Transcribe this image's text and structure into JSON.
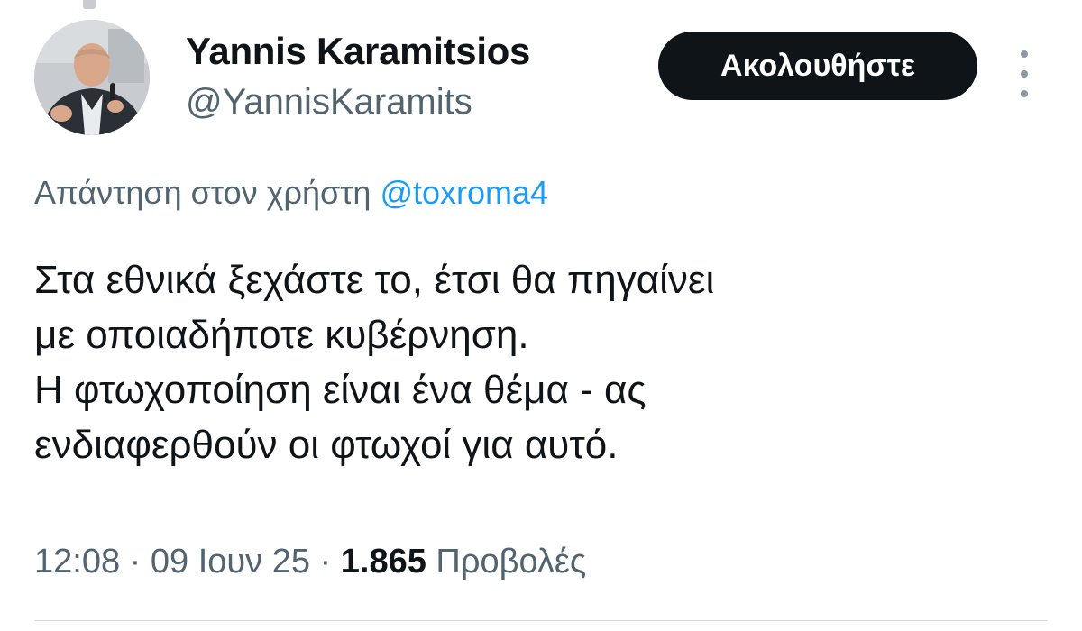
{
  "author": {
    "display_name": "Yannis Karamitsios",
    "handle": "@YannisKaramits",
    "avatar_icon": "profile-photo"
  },
  "follow_button": {
    "label": "Ακολουθήστε"
  },
  "reply_context": {
    "prefix": "Απάντηση στον χρήστη ",
    "mention": "@toxroma4"
  },
  "tweet": {
    "lines": [
      "Στα εθνικά ξεχάστε το, έτσι θα πηγαίνει",
      "με οποιαδήποτε κυβέρνηση.",
      "Η φτωχοποίηση είναι ένα θέμα - ας",
      "ενδιαφερθούν οι φτωχοί για αυτό."
    ]
  },
  "meta": {
    "time": "12:08",
    "separator": " · ",
    "date": "09 Ιουν 25",
    "views_count": "1.865",
    "views_label": " Προβολές"
  },
  "colors": {
    "text": "#0f1419",
    "secondary": "#536471",
    "link": "#1d9bf0",
    "button_bg": "#0f1419"
  }
}
